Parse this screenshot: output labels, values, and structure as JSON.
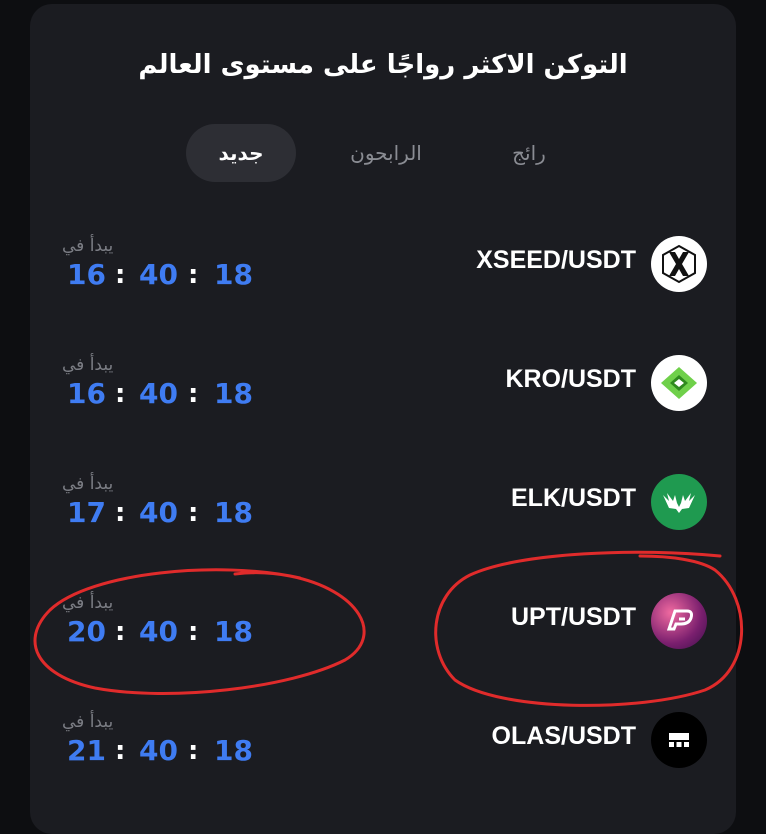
{
  "title": "التوكن الاكثر رواجًا على مستوى العالم",
  "tabs": [
    {
      "label": "رائج"
    },
    {
      "label": "الرابحون"
    },
    {
      "label": "جديد"
    }
  ],
  "rows": [
    {
      "pair": "XSEED/USDT",
      "starts_label": "يبدأ في",
      "h": "16",
      "m": "40",
      "s": "18",
      "icon": "xseed-icon"
    },
    {
      "pair": "KRO/USDT",
      "starts_label": "يبدأ في",
      "h": "16",
      "m": "40",
      "s": "18",
      "icon": "kro-icon"
    },
    {
      "pair": "ELK/USDT",
      "starts_label": "يبدأ في",
      "h": "17",
      "m": "40",
      "s": "18",
      "icon": "elk-icon"
    },
    {
      "pair": "UPT/USDT",
      "starts_label": "يبدأ في",
      "h": "20",
      "m": "40",
      "s": "18",
      "icon": "upt-icon"
    },
    {
      "pair": "OLAS/USDT",
      "starts_label": "يبدأ في",
      "h": "21",
      "m": "40",
      "s": "18",
      "icon": "olas-icon"
    }
  ],
  "separator": ":",
  "colors": {
    "accent": "#3f7cf2",
    "annotation": "#e53935",
    "active_tab": "#2d2e34"
  }
}
